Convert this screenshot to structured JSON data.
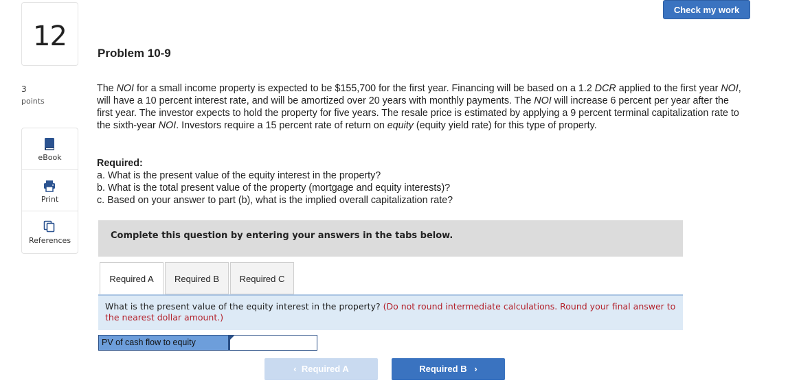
{
  "question": {
    "number": "12",
    "points_value": "3",
    "points_label": "points"
  },
  "tools": [
    {
      "label": "eBook",
      "icon": "book-icon"
    },
    {
      "label": "Print",
      "icon": "printer-icon"
    },
    {
      "label": "References",
      "icon": "references-icon"
    }
  ],
  "header": {
    "check_label": "Check my work"
  },
  "problem": {
    "title": "Problem 10-9",
    "text_p1": "The ",
    "noi": "NOI",
    "text_p2": " for a small income property is expected to be $155,700 for the first year. Financing will be based on a 1.2 ",
    "dcr": "DCR",
    "text_p3": " applied to the first year ",
    "text_p4": ", will have a 10 percent interest rate, and will be amortized over 20 years with monthly payments. The ",
    "text_p5": " will increase 6 percent per year after the first year. The investor expects to hold the property for five years. The resale price is estimated by applying a 9 percent terminal capitalization rate to the sixth-year ",
    "text_p6": ". Investors require a 15 percent rate of return on ",
    "equity": "equity",
    "text_p7": " (equity yield rate) for this type of property.",
    "required_heading": "Required:",
    "req_a": "a. What is the present value of the equity interest in the property?",
    "req_b": "b. What is the total present value of the property (mortgage and equity interests)?",
    "req_c": "c. Based on your answer to part (b), what is the implied overall capitalization rate?"
  },
  "instructions": "Complete this question by entering your answers in the tabs below.",
  "tabs": [
    {
      "label": "Required A",
      "active": true
    },
    {
      "label": "Required B",
      "active": false
    },
    {
      "label": "Required C",
      "active": false
    }
  ],
  "active_question": {
    "text": "What is the present value of the equity interest in the property? ",
    "note": "(Do not round intermediate calculations. Round your final answer to the nearest dollar amount.)"
  },
  "answer": {
    "label": "PV of cash flow to equity",
    "value": ""
  },
  "nav": {
    "prev_label": "Required A",
    "next_label": "Required B"
  },
  "colors": {
    "accent": "#3a73c0",
    "instructions_bg": "#dcdcdc",
    "question_bg": "#ddeaf6",
    "note_red": "#b3212b"
  }
}
